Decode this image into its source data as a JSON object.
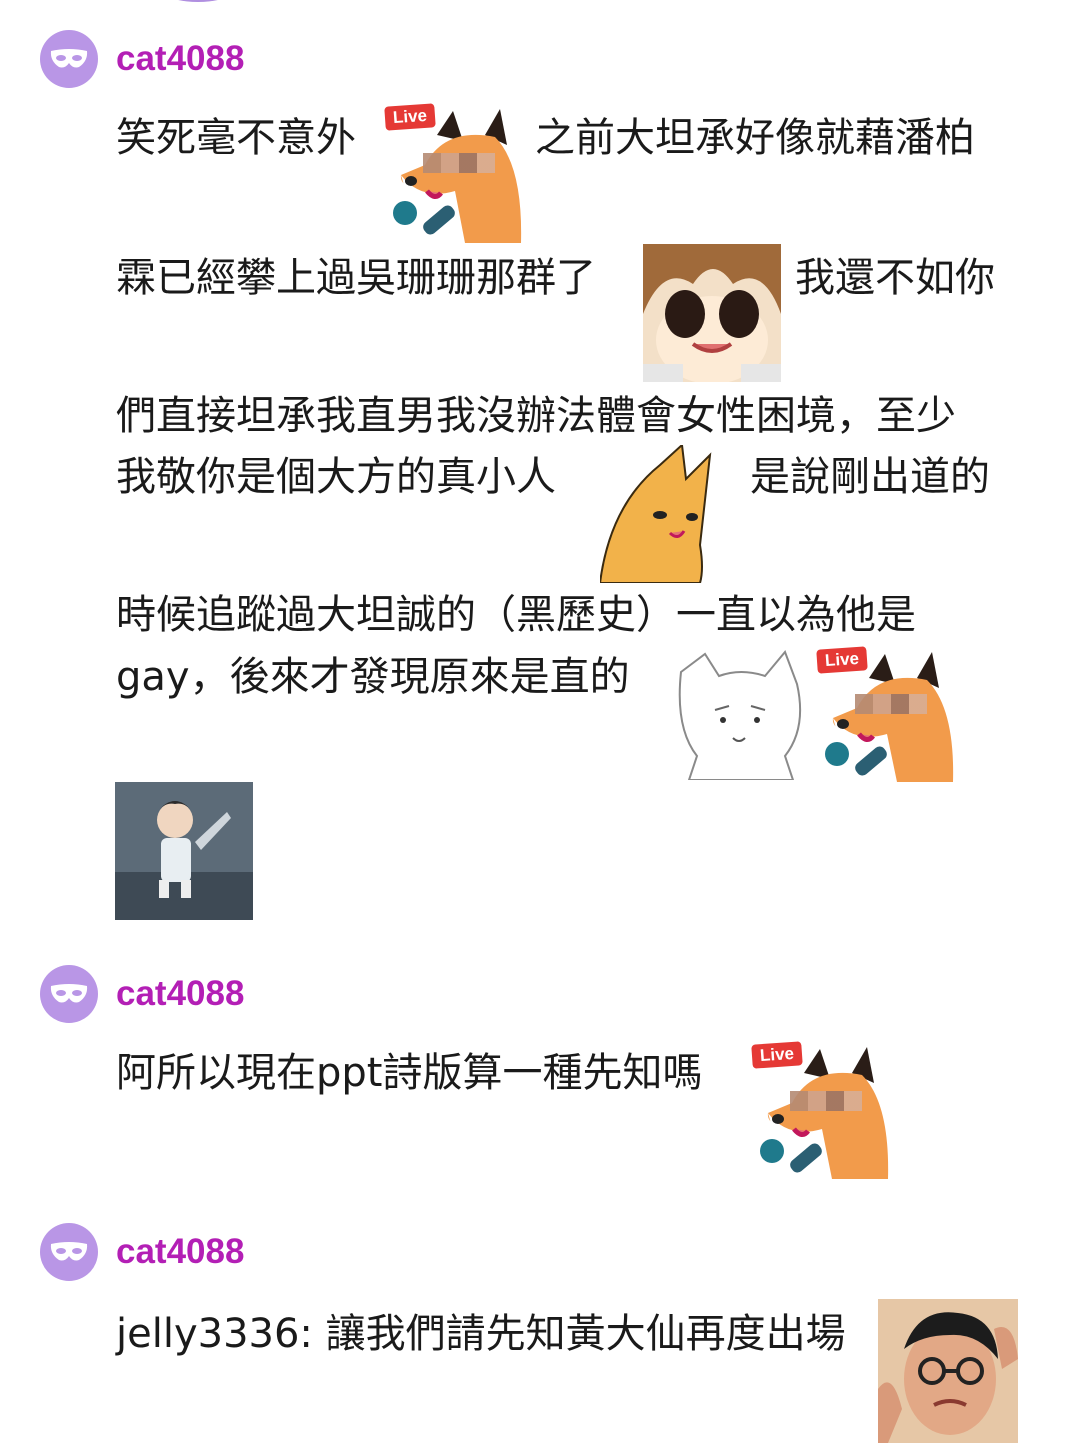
{
  "comments": [
    {
      "username": "cat4088",
      "lines": [
        "笑死毫不意外",
        "之前大坦承好像就藉潘柏",
        "霖已經攀上過吳珊珊那群了",
        "我還不如你",
        "們直接坦承我直男我沒辦法體會女性困境，至少",
        "我敬你是個大方的真小人",
        "是說剛出道的",
        "時候追蹤過大坦誠的（黑歷史）一直以為他是",
        "gay，後來才發現原來是直的"
      ]
    },
    {
      "username": "cat4088",
      "lines": [
        "阿所以現在ppt詩版算一種先知嗎"
      ]
    },
    {
      "username": "cat4088",
      "lines": [
        "jelly3336: 讓我們請先知黃大仙再度出場"
      ]
    }
  ],
  "sticker_badge": "Live",
  "colors": {
    "username": "#b31fb5",
    "avatar_bg": "#b996e6"
  }
}
